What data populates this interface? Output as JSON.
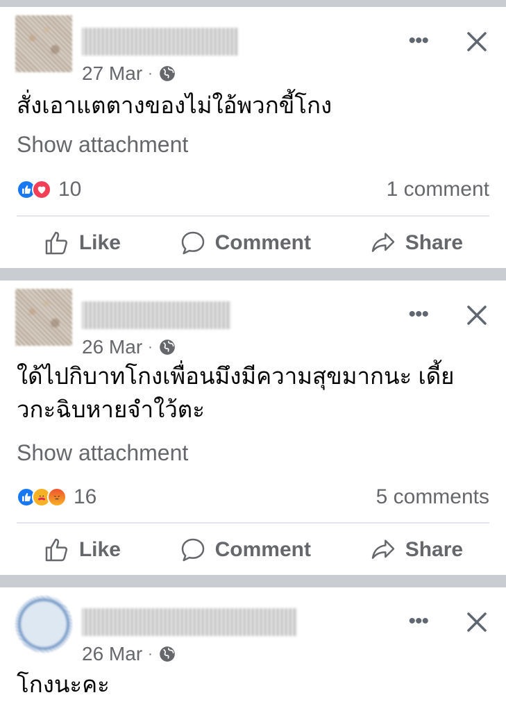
{
  "posts": [
    {
      "date": "27 Mar",
      "text": "สั่งเอาแตตางของไม่ใอ้พวกขี้โกง",
      "attachment_label": "Show attachment",
      "reaction_count": "10",
      "comments_label": "1 comment"
    },
    {
      "date": "26 Mar",
      "text": "ใด้ไปกิบาทโกงเพื่อนมึงมีความสุขมากนะ เดี้ยวกะฉิบหายจำใว้ตะ",
      "attachment_label": "Show attachment",
      "reaction_count": "16",
      "comments_label": "5 comments"
    },
    {
      "date": "26 Mar",
      "text": "โกงนะคะ"
    }
  ],
  "actions": {
    "like": "Like",
    "comment": "Comment",
    "share": "Share"
  },
  "icons": {
    "privacy": "globe-icon",
    "more": "more-icon",
    "close": "close-icon"
  },
  "colors": {
    "like_blue": "#1877f2",
    "love_red": "#f33e58",
    "secondary_text": "#65676b",
    "separator": "#c9ccd1"
  }
}
